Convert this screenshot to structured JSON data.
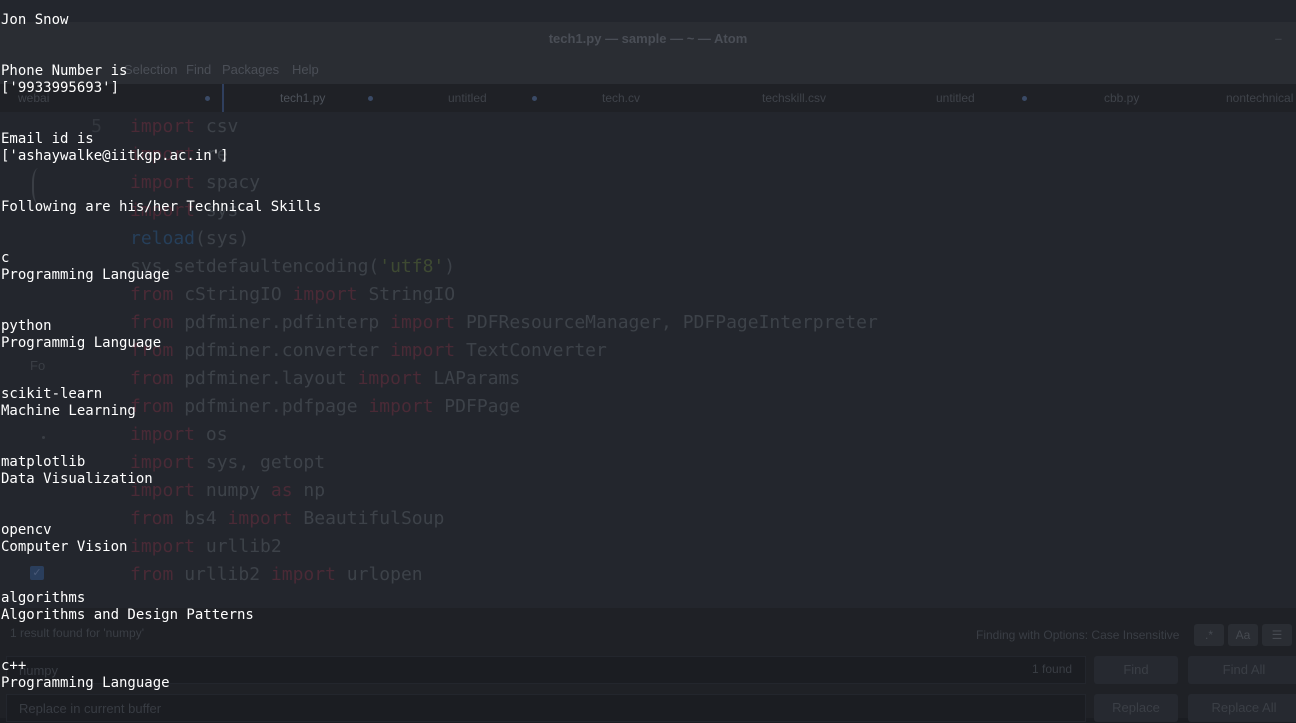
{
  "atom": {
    "window_title": "tech1.py — sample — ~ — Atom",
    "window_control": "–",
    "menu": [
      "Selection",
      "Find",
      "Packages",
      "Help"
    ],
    "tabs": [
      {
        "label": "webai",
        "modified": true
      },
      {
        "label": "tech1.py",
        "modified": true,
        "active": true
      },
      {
        "label": "untitled",
        "modified": true
      },
      {
        "label": "tech.cv",
        "modified": false
      },
      {
        "label": "techskill.csv",
        "modified": false
      },
      {
        "label": "untitled",
        "modified": true
      },
      {
        "label": "cbb.py",
        "modified": false
      },
      {
        "label": "nontechnical",
        "modified": false
      }
    ],
    "line_numbers": [
      "5",
      "",
      "",
      "",
      "",
      "",
      "",
      "",
      "",
      "",
      "",
      "",
      "",
      "",
      "",
      "",
      ""
    ],
    "code_lines": [
      [
        {
          "t": "import",
          "c": "kw"
        },
        {
          "t": " csv"
        }
      ],
      [
        {
          "t": "import",
          "c": "kw"
        },
        {
          "t": " re"
        }
      ],
      [
        {
          "t": "import",
          "c": "kw"
        },
        {
          "t": " spacy"
        }
      ],
      [
        {
          "t": "import",
          "c": "kw"
        },
        {
          "t": " sys"
        }
      ],
      [
        {
          "t": "reload",
          "c": "fn"
        },
        {
          "t": "(sys)"
        }
      ],
      [
        {
          "t": "sys.setdefaultencoding("
        },
        {
          "t": "'utf8'",
          "c": "st"
        },
        {
          "t": ")"
        }
      ],
      [
        {
          "t": "from",
          "c": "kw"
        },
        {
          "t": " cStringIO "
        },
        {
          "t": "import",
          "c": "kw"
        },
        {
          "t": " StringIO"
        }
      ],
      [
        {
          "t": "from",
          "c": "kw"
        },
        {
          "t": " pdfminer.pdfinterp "
        },
        {
          "t": "import",
          "c": "kw"
        },
        {
          "t": " PDFResourceManager, PDFPageInterpreter"
        }
      ],
      [
        {
          "t": "from",
          "c": "kw"
        },
        {
          "t": " pdfminer.converter "
        },
        {
          "t": "import",
          "c": "kw"
        },
        {
          "t": " TextConverter"
        }
      ],
      [
        {
          "t": "from",
          "c": "kw"
        },
        {
          "t": " pdfminer.layout "
        },
        {
          "t": "import",
          "c": "kw"
        },
        {
          "t": " LAParams"
        }
      ],
      [
        {
          "t": "from",
          "c": "kw"
        },
        {
          "t": " pdfminer.pdfpage "
        },
        {
          "t": "import",
          "c": "kw"
        },
        {
          "t": " PDFPage"
        }
      ],
      [
        {
          "t": "import",
          "c": "kw"
        },
        {
          "t": " os"
        }
      ],
      [
        {
          "t": "import",
          "c": "kw"
        },
        {
          "t": " sys, getopt"
        }
      ],
      [
        {
          "t": "import",
          "c": "kw"
        },
        {
          "t": " numpy "
        },
        {
          "t": "as",
          "c": "kw"
        },
        {
          "t": " np"
        }
      ],
      [
        {
          "t": "from",
          "c": "kw"
        },
        {
          "t": " bs4 "
        },
        {
          "t": "import",
          "c": "kw"
        },
        {
          "t": " BeautifulSoup"
        }
      ],
      [
        {
          "t": "import",
          "c": "kw"
        },
        {
          "t": " urllib2"
        }
      ],
      [
        {
          "t": "from",
          "c": "kw"
        },
        {
          "t": " urllib2 "
        },
        {
          "t": "import",
          "c": "kw"
        },
        {
          "t": " urlopen"
        }
      ]
    ],
    "find": {
      "results_text": "1 result found for 'numpy'",
      "options_label": "Finding with Options:",
      "options_value": "Case Insensitive",
      "option_buttons": [
        ".*",
        "Aa",
        "☰"
      ],
      "find_value": "numpy",
      "found_count": "1 found",
      "find_button": "Find",
      "find_all_button": "Find All",
      "replace_placeholder": "Replace in current buffer",
      "replace_button": "Replace",
      "replace_all_button": "Replace All"
    },
    "sidebar_ghost": "Fo"
  },
  "terminal": {
    "lines": [
      "Jon Snow",
      "",
      "",
      "Phone Number is",
      "['9933995693']",
      "",
      "",
      "Email id is",
      "['ashaywalke@iitkgp.ac.in']",
      "",
      "",
      "Following are his/her Technical Skills",
      "",
      "",
      "c",
      "Programming Language",
      "",
      "",
      "python",
      "Programmig Language",
      "",
      "",
      "scikit-learn",
      "Machine Learning",
      "",
      "",
      "matplotlib",
      "Data Visualization",
      "",
      "",
      "opencv",
      "Computer Vision",
      "",
      "",
      "algorithms",
      "Algorithms and Design Patterns",
      "",
      "",
      "c++",
      "Programming Language"
    ]
  }
}
